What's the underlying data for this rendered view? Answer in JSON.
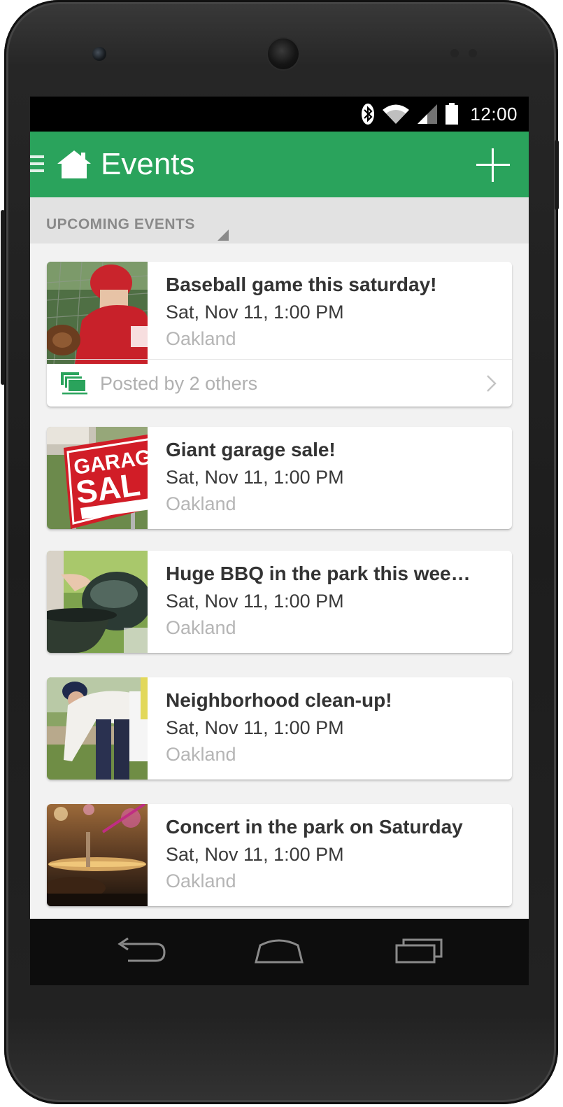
{
  "status_bar": {
    "time": "12:00",
    "icons": [
      "bluetooth-icon",
      "wifi-icon",
      "signal-icon",
      "battery-icon"
    ]
  },
  "app_bar": {
    "title": "Events",
    "home_icon": "home-icon",
    "menu_icon": "menu-icon",
    "action_icon": "add-icon",
    "color": "#2aa35c"
  },
  "section": {
    "title": "UPCOMING EVENTS"
  },
  "events": [
    {
      "title": "Baseball game this saturday!",
      "date": "Sat, Nov 11, 1:00 PM",
      "location": "Oakland",
      "thumbnail": "baseball-player-photo",
      "footer": "Posted by 2 others"
    },
    {
      "title": "Giant garage sale!",
      "date": "Sat, Nov 11, 1:00 PM",
      "location": "Oakland",
      "thumbnail": "garage-sale-sign-photo",
      "thumbnail_sign": "GARAGE SAL"
    },
    {
      "title": "Huge BBQ in the park this wee…",
      "date": "Sat, Nov 11, 1:00 PM",
      "location": "Oakland",
      "thumbnail": "bbq-grill-photo"
    },
    {
      "title": "Neighborhood clean-up!",
      "date": "Sat, Nov 11, 1:00 PM",
      "location": "Oakland",
      "thumbnail": "cleanup-volunteer-photo"
    },
    {
      "title": "Concert in the park on Saturday",
      "date": "Sat, Nov 11, 1:00 PM",
      "location": "Oakland",
      "thumbnail": "concert-drums-photo"
    }
  ],
  "nav_bar": {
    "buttons": [
      "back-icon",
      "home-icon",
      "recent-apps-icon"
    ]
  }
}
